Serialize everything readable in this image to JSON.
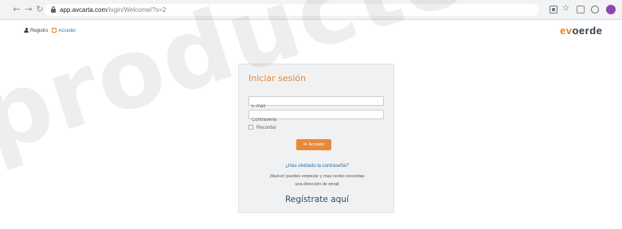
{
  "browser": {
    "back_icon": "back-arrow-icon",
    "forward_icon": "forward-arrow-icon",
    "reload_icon": "reload-icon",
    "url_host": "app.avcarta.com",
    "url_path": "/login/Welcome/?s=2"
  },
  "header": {
    "register_link": "Registro",
    "login_link": "Acceder",
    "logo_accent": "ev",
    "logo_rest": "oerde"
  },
  "watermark": "productores",
  "login": {
    "title": "Iniciar sesión",
    "email_placeholder": "E-mail",
    "password_placeholder": "Contraseña",
    "remember_label": "Recordar",
    "submit_label": "Acceder",
    "forgot_link": "¿Has olvidado la contraseña?",
    "note_line1": "¡Nuevo! puedes empezar y mas recibo necesitas",
    "note_line2": "una dirección de email",
    "register_link": "Regístrate aquí"
  },
  "colors": {
    "accent": "#e8893a",
    "link": "#2a6fa3",
    "card_bg": "#f0f1f2"
  }
}
